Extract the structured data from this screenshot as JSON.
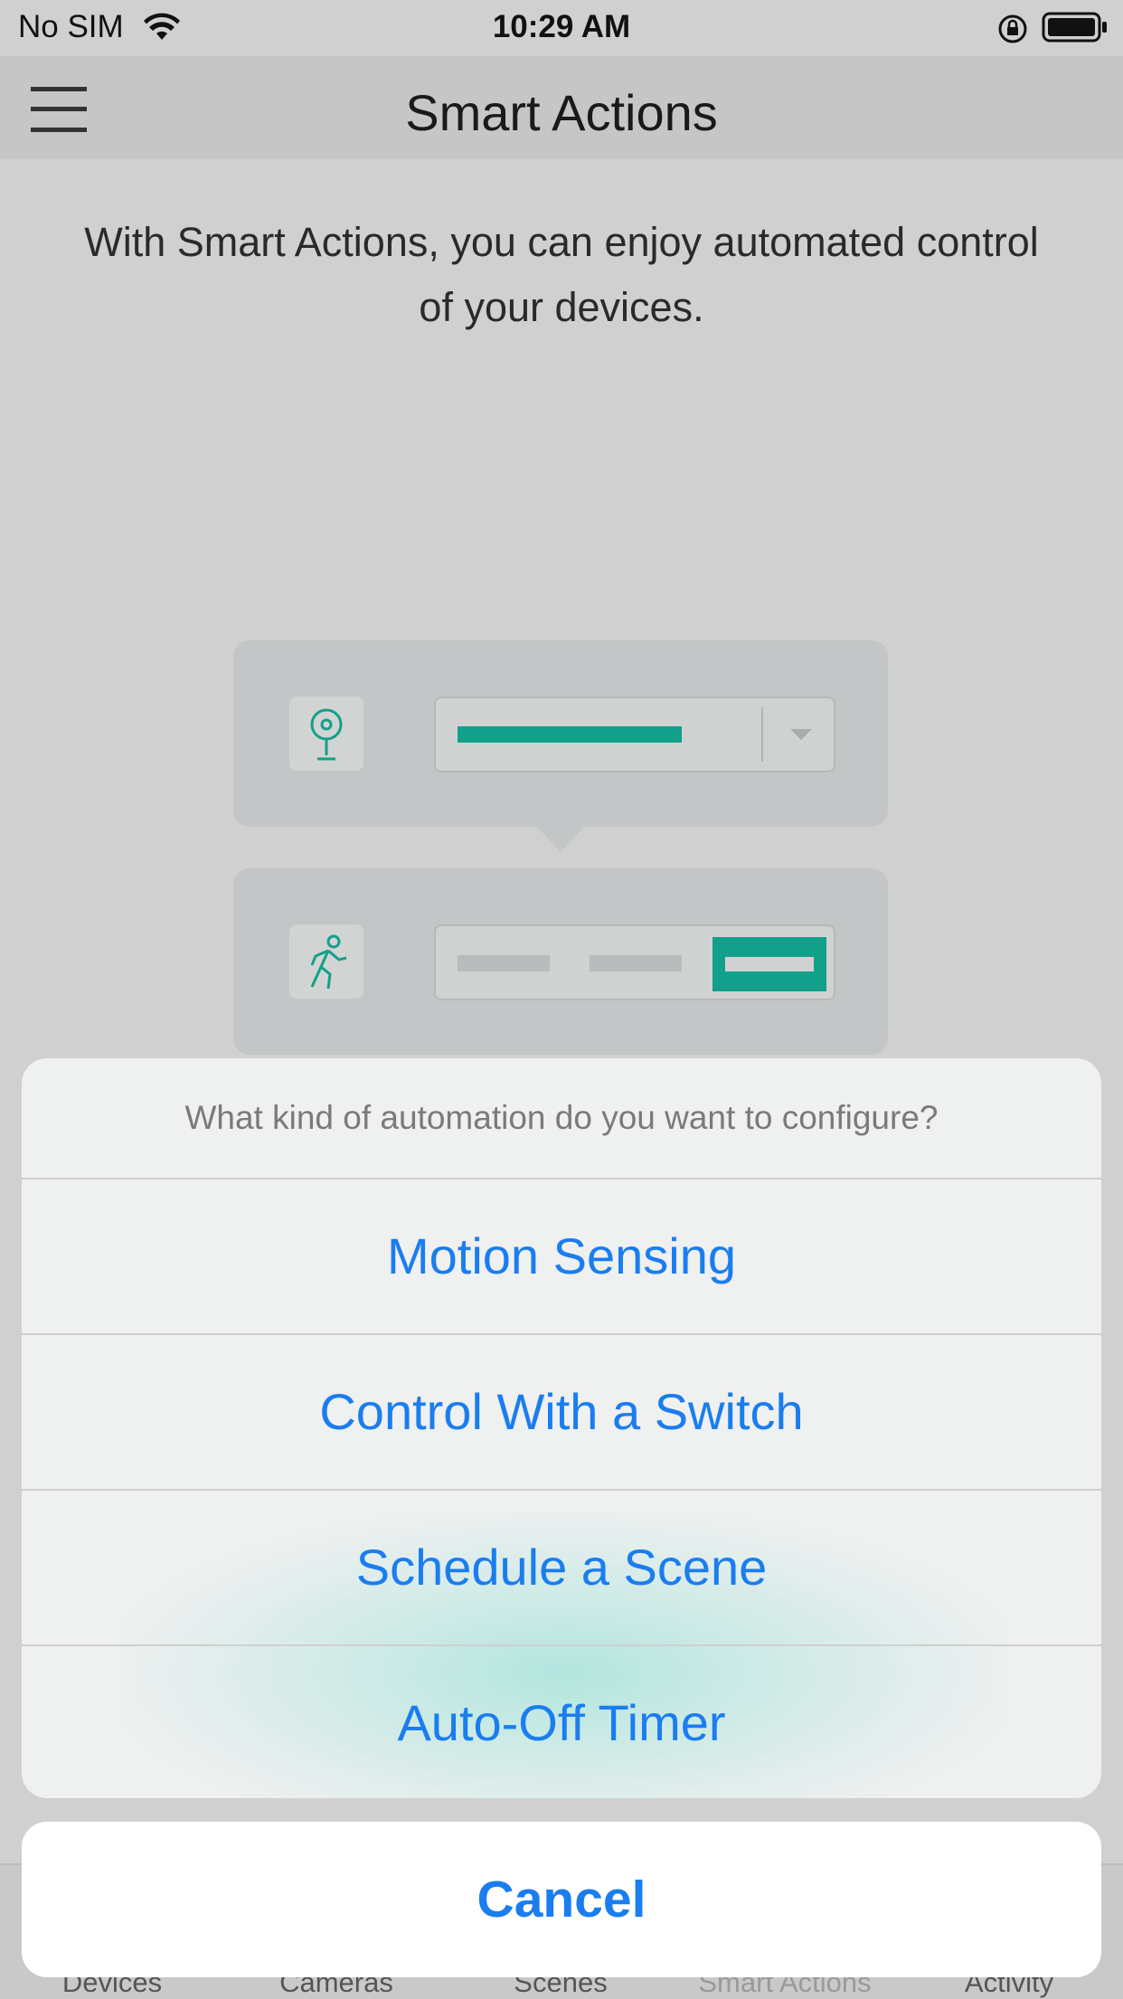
{
  "status_bar": {
    "carrier": "No SIM",
    "time": "10:29 AM",
    "icons": [
      "wifi-icon",
      "rotation-lock-icon",
      "battery-icon"
    ]
  },
  "nav": {
    "title": "Smart Actions",
    "menu_icon": "hamburger-menu-icon"
  },
  "intro_text": "With Smart Actions, you can enjoy automated control of your devices.",
  "illustration": {
    "icons": [
      "camera-icon",
      "walking-person-icon"
    ],
    "accent_color": "#12a08a"
  },
  "tab_bar": {
    "tabs": [
      {
        "label": "Devices"
      },
      {
        "label": "Cameras"
      },
      {
        "label": "Scenes"
      },
      {
        "label": "Smart Actions"
      },
      {
        "label": "Activity"
      }
    ]
  },
  "action_sheet": {
    "question": "What kind of automation do you want to configure?",
    "options": [
      {
        "label": "Motion Sensing"
      },
      {
        "label": "Control With a Switch"
      },
      {
        "label": "Schedule a Scene"
      },
      {
        "label": "Auto-Off Timer"
      }
    ],
    "cancel_label": "Cancel",
    "action_color": "#1a7df0"
  }
}
